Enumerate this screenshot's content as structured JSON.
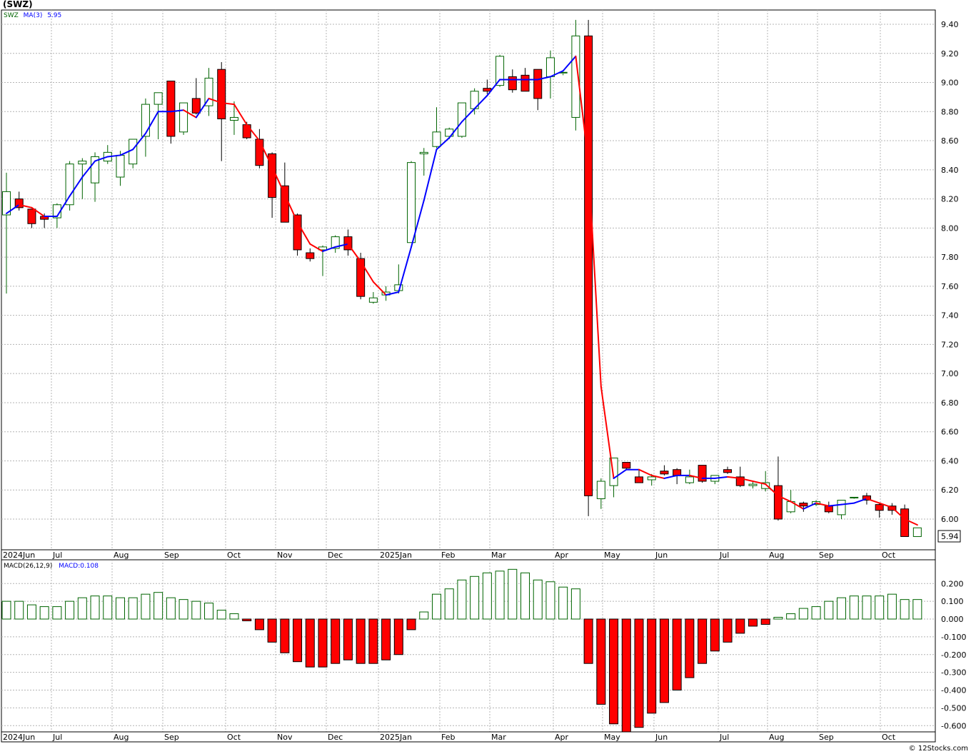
{
  "ticker_title": "(SWZ)",
  "watermark": "© 12Stocks.com",
  "colors": {
    "up_candle_stroke": "#006400",
    "down_candle_fill": "#ff0000",
    "ma_up": "#0000ff",
    "ma_down": "#ff0000",
    "macd_pos": "#006400",
    "macd_neg": "#ff0000",
    "grid": "#b4b4b4"
  },
  "legend": {
    "symbol": "SWZ",
    "ma_label": "MA(3)",
    "ma_value": "5.95",
    "macd_label": "MACD(26,12,9)",
    "macd_value": "MACD:0.108"
  },
  "last_price_label": "5.94",
  "months": [
    "2024Jun",
    "Jul",
    "Aug",
    "Sep",
    "Oct",
    "Nov",
    "Dec",
    "2025Jan",
    "Feb",
    "Mar",
    "Apr",
    "May",
    "Jun",
    "Jul",
    "Aug",
    "Sep",
    "Oct"
  ],
  "chart_data": [
    {
      "type": "candlestick",
      "title": "(SWZ)",
      "ylim": [
        5.85,
        9.5
      ],
      "yticks": [
        "9.40",
        "9.20",
        "9.00",
        "8.80",
        "8.60",
        "8.40",
        "8.20",
        "8.00",
        "7.80",
        "7.60",
        "7.40",
        "7.20",
        "7.00",
        "6.80",
        "6.60",
        "6.40",
        "6.20",
        "6.00"
      ],
      "xlabels": [
        "2024Jun",
        "Jul",
        "Aug",
        "Sep",
        "Oct",
        "Nov",
        "Dec",
        "2025Jan",
        "Feb",
        "Mar",
        "Apr",
        "May",
        "Jun",
        "Jul",
        "Aug",
        "Sep",
        "Oct"
      ],
      "grid": true,
      "series": [
        {
          "name": "SWZ",
          "ohlc": [
            [
              8.09,
              8.38,
              7.55,
              8.25
            ],
            [
              8.2,
              8.25,
              8.12,
              8.14
            ],
            [
              8.13,
              8.13,
              8.0,
              8.03
            ],
            [
              8.08,
              8.1,
              8.0,
              8.06
            ],
            [
              8.07,
              8.17,
              8.0,
              8.16
            ],
            [
              8.16,
              8.46,
              8.12,
              8.44
            ],
            [
              8.44,
              8.48,
              8.2,
              8.46
            ],
            [
              8.31,
              8.52,
              8.18,
              8.49
            ],
            [
              8.46,
              8.57,
              8.44,
              8.52
            ],
            [
              8.35,
              8.53,
              8.29,
              8.5
            ],
            [
              8.44,
              8.61,
              8.41,
              8.61
            ],
            [
              8.63,
              8.89,
              8.49,
              8.85
            ],
            [
              8.85,
              8.92,
              8.61,
              8.93
            ],
            [
              9.01,
              9.01,
              8.58,
              8.63
            ],
            [
              8.66,
              8.86,
              8.64,
              8.86
            ],
            [
              8.89,
              9.03,
              8.78,
              8.79
            ],
            [
              8.84,
              9.1,
              8.77,
              9.03
            ],
            [
              9.09,
              9.14,
              8.46,
              8.75
            ],
            [
              8.74,
              8.87,
              8.64,
              8.76
            ],
            [
              8.71,
              8.73,
              8.61,
              8.62
            ],
            [
              8.61,
              8.68,
              8.41,
              8.43
            ],
            [
              8.51,
              8.52,
              8.07,
              8.21
            ],
            [
              8.29,
              8.45,
              8.05,
              8.04
            ],
            [
              8.09,
              8.1,
              7.81,
              7.85
            ],
            [
              7.83,
              7.86,
              7.77,
              7.79
            ],
            [
              7.85,
              7.88,
              7.67,
              7.87
            ],
            [
              7.86,
              7.95,
              7.83,
              7.94
            ],
            [
              7.94,
              7.99,
              7.81,
              7.85
            ],
            [
              7.79,
              7.83,
              7.51,
              7.53
            ],
            [
              7.49,
              7.56,
              7.48,
              7.52
            ],
            [
              7.54,
              7.6,
              7.5,
              7.56
            ],
            [
              7.57,
              7.75,
              7.55,
              7.61
            ],
            [
              7.9,
              8.46,
              7.9,
              8.45
            ],
            [
              8.51,
              8.55,
              8.36,
              8.52
            ],
            [
              8.56,
              8.83,
              8.55,
              8.66
            ],
            [
              8.63,
              8.69,
              8.61,
              8.68
            ],
            [
              8.63,
              8.86,
              8.62,
              8.86
            ],
            [
              8.82,
              8.96,
              8.78,
              8.94
            ],
            [
              8.96,
              9.02,
              8.92,
              8.94
            ],
            [
              8.98,
              9.19,
              8.97,
              9.18
            ],
            [
              9.04,
              9.09,
              8.93,
              8.95
            ],
            [
              9.05,
              9.1,
              8.96,
              8.94
            ],
            [
              9.09,
              9.09,
              8.81,
              8.89
            ],
            [
              9.04,
              9.22,
              8.89,
              9.17
            ],
            [
              9.07,
              9.06,
              9.05,
              9.07
            ],
            [
              8.76,
              9.43,
              8.67,
              9.32
            ],
            [
              9.32,
              9.43,
              6.02,
              6.16
            ],
            [
              6.14,
              6.28,
              6.07,
              6.26
            ],
            [
              6.23,
              6.42,
              6.15,
              6.42
            ],
            [
              6.39,
              6.39,
              6.34,
              6.35
            ],
            [
              6.29,
              6.34,
              6.25,
              6.25
            ],
            [
              6.27,
              6.31,
              6.23,
              6.29
            ],
            [
              6.33,
              6.37,
              6.3,
              6.31
            ],
            [
              6.34,
              6.35,
              6.24,
              6.3
            ],
            [
              6.25,
              6.34,
              6.24,
              6.29
            ],
            [
              6.37,
              6.37,
              6.25,
              6.26
            ],
            [
              6.26,
              6.3,
              6.24,
              6.3
            ],
            [
              6.34,
              6.36,
              6.31,
              6.32
            ],
            [
              6.29,
              6.36,
              6.22,
              6.23
            ],
            [
              6.23,
              6.26,
              6.21,
              6.24
            ],
            [
              6.21,
              6.33,
              6.19,
              6.25
            ],
            [
              6.23,
              6.43,
              5.99,
              6.0
            ],
            [
              6.05,
              6.2,
              6.04,
              6.12
            ],
            [
              6.11,
              6.12,
              6.05,
              6.09
            ],
            [
              6.1,
              6.13,
              6.09,
              6.12
            ],
            [
              6.09,
              6.12,
              6.04,
              6.05
            ],
            [
              6.03,
              6.13,
              6.0,
              6.13
            ],
            [
              6.15,
              6.15,
              6.14,
              6.15
            ],
            [
              6.16,
              6.18,
              6.1,
              6.13
            ],
            [
              6.1,
              6.11,
              6.01,
              6.06
            ],
            [
              6.09,
              6.11,
              6.03,
              6.06
            ],
            [
              6.07,
              6.1,
              5.88,
              5.88
            ],
            [
              5.88,
              5.94,
              5.88,
              5.94
            ]
          ],
          "ma": [
            8.1,
            8.16,
            8.14,
            8.08,
            8.08,
            8.22,
            8.35,
            8.46,
            8.49,
            8.5,
            8.54,
            8.65,
            8.8,
            8.8,
            8.81,
            8.76,
            8.89,
            8.86,
            8.85,
            8.71,
            8.6,
            8.42,
            8.23,
            8.04,
            7.89,
            7.84,
            7.87,
            7.89,
            7.77,
            7.63,
            7.54,
            7.56,
            7.87,
            8.19,
            8.54,
            8.62,
            8.73,
            8.82,
            8.91,
            9.02,
            9.02,
            9.02,
            9.02,
            9.04,
            9.08,
            9.18,
            8.45,
            6.91,
            6.28,
            6.34,
            6.34,
            6.3,
            6.28,
            6.3,
            6.3,
            6.28,
            6.28,
            6.29,
            6.28,
            6.26,
            6.24,
            6.16,
            6.12,
            6.07,
            6.11,
            6.09,
            6.1,
            6.11,
            6.14,
            6.11,
            6.08,
            6.0,
            5.96
          ]
        },
        {
          "name": "MA(3)",
          "note_value": "5.95"
        }
      ]
    },
    {
      "type": "bar",
      "title": "MACD(26,12,9)",
      "ylim": [
        -0.64,
        0.29
      ],
      "yticks": [
        "0.200",
        "0.100",
        "0.000",
        "-0.100",
        "-0.200",
        "-0.300",
        "-0.400",
        "-0.500",
        "-0.600"
      ],
      "xlabels": [
        "2024Jun",
        "Jul",
        "Aug",
        "Sep",
        "Oct",
        "Nov",
        "Dec",
        "2025Jan",
        "Feb",
        "Mar",
        "Apr",
        "May",
        "Jun",
        "Jul",
        "Aug",
        "Sep",
        "Oct"
      ],
      "grid": true,
      "series": [
        {
          "name": "MACD:0.108",
          "values": [
            0.1,
            0.1,
            0.08,
            0.07,
            0.07,
            0.1,
            0.12,
            0.13,
            0.13,
            0.12,
            0.12,
            0.14,
            0.15,
            0.12,
            0.11,
            0.1,
            0.09,
            0.05,
            0.03,
            -0.01,
            -0.06,
            -0.13,
            -0.19,
            -0.24,
            -0.27,
            -0.27,
            -0.25,
            -0.23,
            -0.25,
            -0.25,
            -0.23,
            -0.2,
            -0.06,
            0.04,
            0.14,
            0.17,
            0.22,
            0.24,
            0.26,
            0.27,
            0.28,
            0.26,
            0.22,
            0.21,
            0.18,
            0.17,
            -0.25,
            -0.48,
            -0.59,
            -0.64,
            -0.61,
            -0.53,
            -0.47,
            -0.4,
            -0.33,
            -0.25,
            -0.18,
            -0.13,
            -0.08,
            -0.04,
            -0.03,
            0.01,
            0.03,
            0.06,
            0.07,
            0.1,
            0.12,
            0.13,
            0.13,
            0.13,
            0.14,
            0.11,
            0.11
          ]
        }
      ]
    }
  ]
}
